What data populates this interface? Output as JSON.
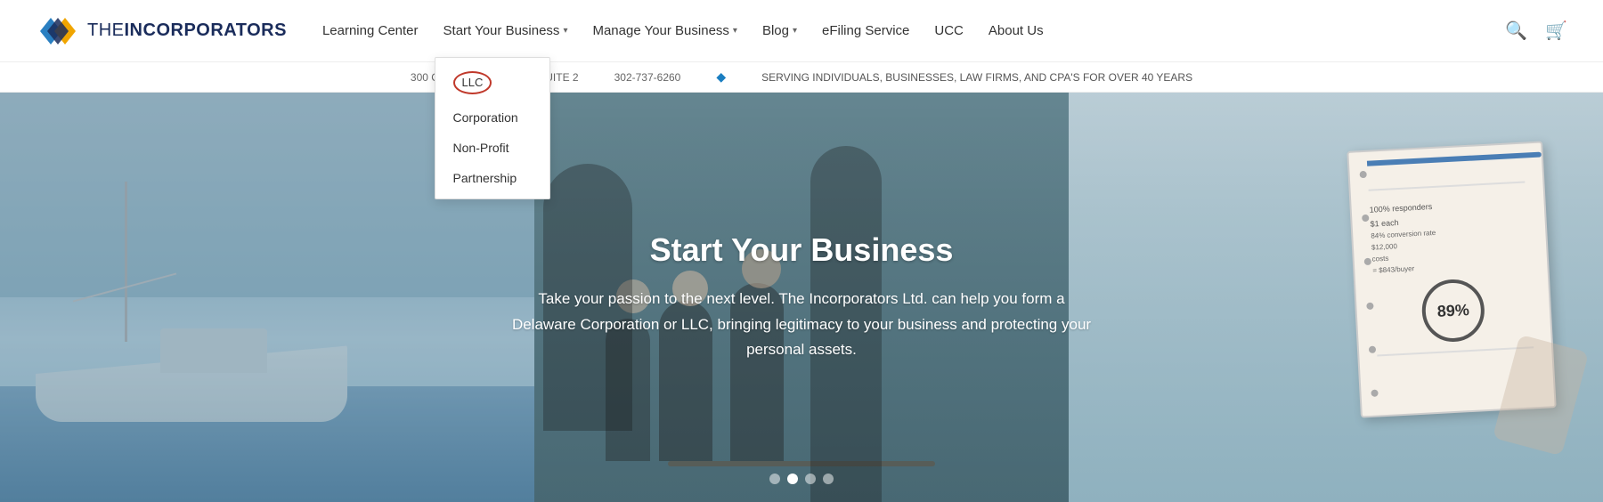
{
  "brand": {
    "name_prefix": "THE",
    "name_main": "INCORPORATORS",
    "tagline": "The Incorporators"
  },
  "header": {
    "address": "300 CREEK VIEW ROAD, SUITE 2",
    "phone": "302-737-6260",
    "serving": "SERVING INDIVIDUALS, BUSINESSES, LAW FIRMS, AND CPA'S FOR OVER 40 YEARS"
  },
  "nav": {
    "items": [
      {
        "label": "Learning Center",
        "has_dropdown": false
      },
      {
        "label": "Start Your Business",
        "has_dropdown": true
      },
      {
        "label": "Manage Your Business",
        "has_dropdown": true
      },
      {
        "label": "Blog",
        "has_dropdown": true
      },
      {
        "label": "eFiling Service",
        "has_dropdown": false
      },
      {
        "label": "UCC",
        "has_dropdown": false
      },
      {
        "label": "About Us",
        "has_dropdown": false
      }
    ]
  },
  "dropdown": {
    "trigger": "Start Your Business",
    "items": [
      {
        "label": "LLC",
        "circled": true
      },
      {
        "label": "Corporation",
        "circled": false
      },
      {
        "label": "Non-Profit",
        "circled": false
      },
      {
        "label": "Partnership",
        "circled": false
      }
    ]
  },
  "hero": {
    "title": "Start Your Business",
    "subtitle": "Take your passion to the next level. The Incorporators Ltd. can help you form a Delaware Corporation or LLC, bringing legitimacy to your business and protecting your personal assets.",
    "dots": [
      {
        "active": false
      },
      {
        "active": true
      },
      {
        "active": false
      },
      {
        "active": false
      }
    ]
  },
  "icons": {
    "search": "🔍",
    "cart": "🛒",
    "chevron": "▾",
    "diamond": "◆"
  }
}
